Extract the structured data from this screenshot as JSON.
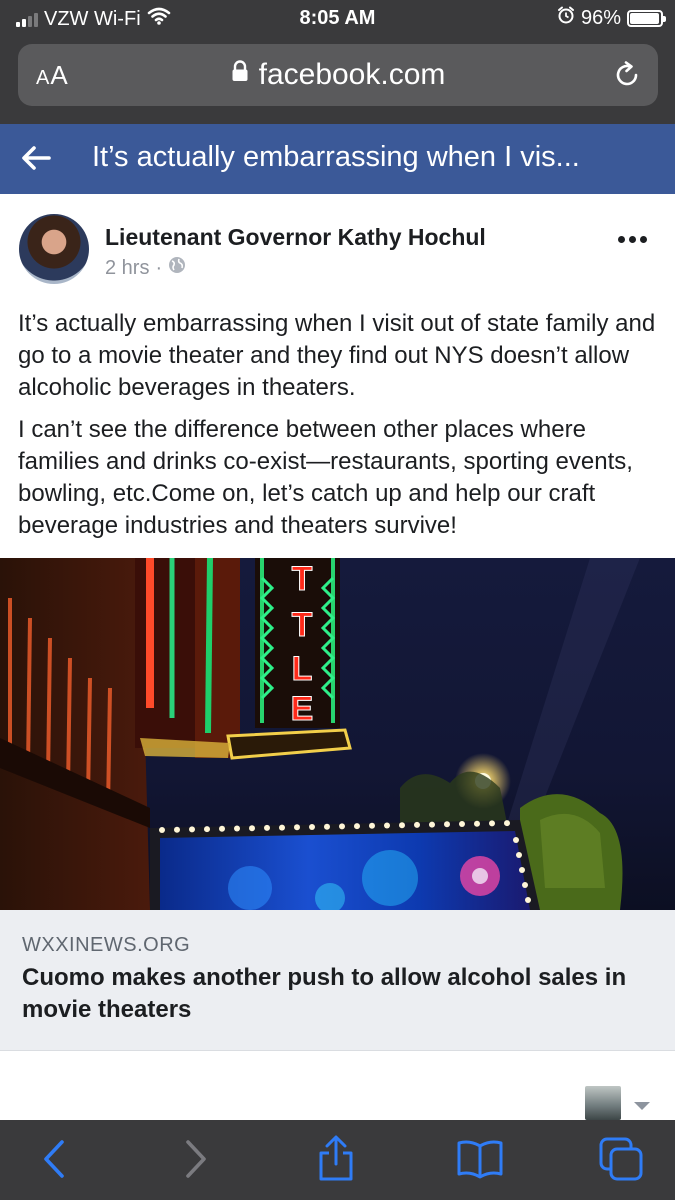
{
  "status_bar": {
    "carrier": "VZW Wi-Fi",
    "time": "8:05 AM",
    "battery_percent": "96%",
    "battery_level": 0.96,
    "signal_bars": 2,
    "icons": [
      "signal-bars-icon",
      "wifi-icon",
      "alarm-icon",
      "battery-icon"
    ]
  },
  "browser": {
    "reader_button": "AA",
    "url": "facebook.com",
    "icons": [
      "lock-icon",
      "reload-icon"
    ]
  },
  "fb_header": {
    "title": "It’s actually embarrassing when I vis...",
    "icons": [
      "back-arrow-icon"
    ]
  },
  "post": {
    "author": "Lieutenant Governor Kathy Hochul",
    "time": "2 hrs",
    "separator": "·",
    "paragraphs": [
      "It’s actually embarrassing when I visit out of state family and go to a movie theater and they find out NYS doesn’t allow alcoholic beverages in theaters.",
      "I can’t see the difference between other places where families and drinks co-exist—restaurants, sporting events, bowling, etc.Come on, let’s catch up and help our craft beverage industries and theaters survive!"
    ],
    "icons": [
      "globe-icon",
      "more-options-icon"
    ]
  },
  "link_preview": {
    "source": "WXXINEWS.ORG",
    "headline": "Cuomo makes another push to allow alcohol sales in movie theaters",
    "sign_letters": [
      "T",
      "T",
      "L",
      "E"
    ]
  },
  "toolbar": {
    "icons": [
      "back-icon",
      "forward-icon",
      "share-icon",
      "bookmarks-icon",
      "tabs-icon"
    ]
  },
  "colors": {
    "fb_blue": "#3b5998",
    "safari_chrome": "#3a3a3c",
    "ios_blue": "#2f7cf6",
    "caption_bg": "#eceef2"
  }
}
